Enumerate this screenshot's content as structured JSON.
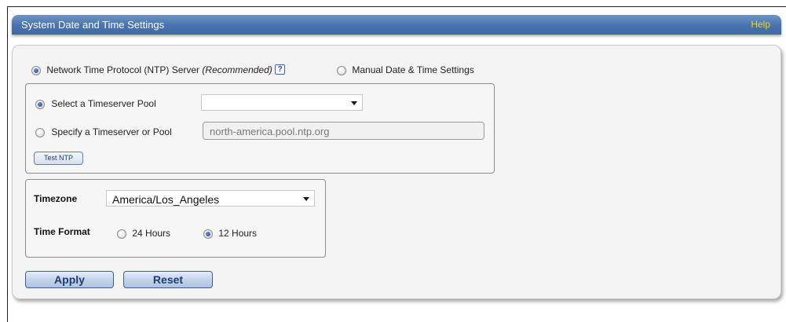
{
  "header": {
    "title": "System Date and Time Settings",
    "help_label": "Help"
  },
  "mode": {
    "ntp_label": "Network Time Protocol (NTP) Server",
    "ntp_recommended": "(Recommended)",
    "ntp_help_glyph": "?",
    "ntp_selected": true,
    "manual_label": "Manual Date & Time Settings",
    "manual_selected": false
  },
  "ntp": {
    "pool_option_label": "Select a Timeserver Pool",
    "pool_option_selected": true,
    "pool_select_value": "",
    "specify_option_label": "Specify a Timeserver or Pool",
    "specify_option_selected": false,
    "specify_input_value": "north-america.pool.ntp.org",
    "test_button_label": "Test NTP"
  },
  "timezone": {
    "label": "Timezone",
    "value": "America/Los_Angeles"
  },
  "time_format": {
    "label": "Time Format",
    "option_24": "24 Hours",
    "option_24_selected": false,
    "option_12": "12 Hours",
    "option_12_selected": true
  },
  "actions": {
    "apply_label": "Apply",
    "reset_label": "Reset"
  },
  "colors": {
    "title_bar": "#4a75b0",
    "help_link": "#f6d421",
    "button_text": "#1d3d72"
  }
}
